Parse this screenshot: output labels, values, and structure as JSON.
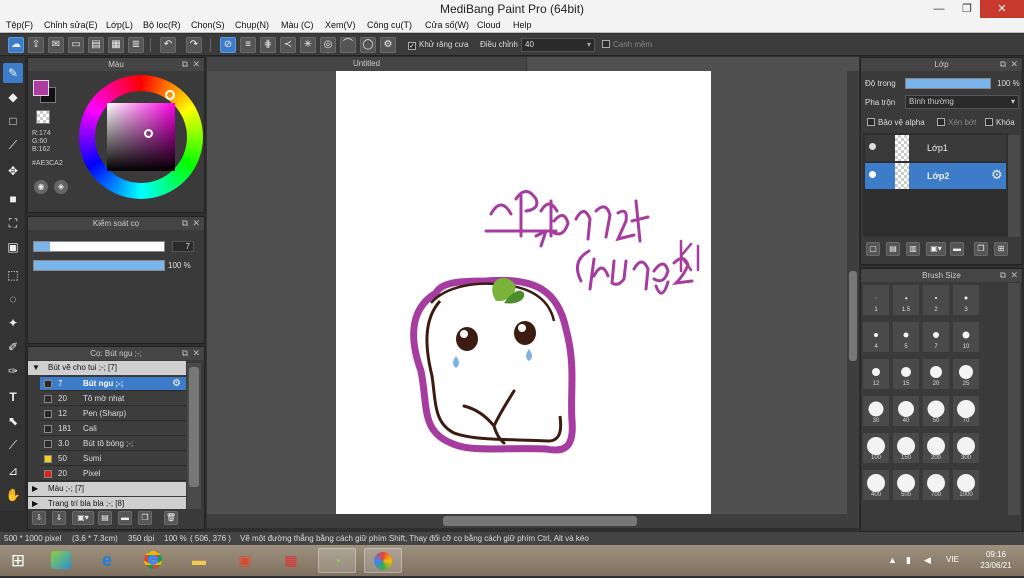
{
  "window": {
    "title": "MediBang Paint Pro (64bit)",
    "min": "—",
    "max": "❐",
    "close": "✕"
  },
  "menu": [
    "Tệp(F)",
    "Chỉnh sửa(E)",
    "Lớp(L)",
    "Bộ lọc(R)",
    "Chọn(S)",
    "Chụp(N)",
    "Màu (C)",
    "Xem(V)",
    "Công cụ(T)",
    "Cửa số(W)",
    "Cloud",
    "Help"
  ],
  "toolbar": {
    "antialias_label": "Khử răng cưa",
    "adjust_label": "Điều chỉnh",
    "adjust_value": "40",
    "edge_label": "Canh mềm"
  },
  "color_panel": {
    "title": "Màu",
    "r": "R:174",
    "g": "G:60",
    "b": "B:162",
    "hex": "#AE3CA2",
    "main_color": "#ae3ca2"
  },
  "brush_control": {
    "title": "Kiểm soát cọ",
    "size": "7",
    "opacity": "100 %"
  },
  "brush_panel": {
    "title": "Cọ: Bút ngu ;-;",
    "group1": "Bút vẽ cho tui ;-; [7]",
    "rows": [
      {
        "size": "7",
        "name": "Bút ngu ;-;",
        "color": "#2a2a2a",
        "selected": true
      },
      {
        "size": "20",
        "name": "Tô mờ nhạt",
        "color": "#2a2a2a"
      },
      {
        "size": "12",
        "name": "Pen (Sharp)",
        "color": "#2a2a2a"
      },
      {
        "size": "181",
        "name": "Cali",
        "color": "#2a2a2a"
      },
      {
        "size": "3.0",
        "name": "Bút tô bóng ;-;",
        "color": "#2a2a2a"
      },
      {
        "size": "50",
        "name": "Sumi",
        "color": "#f2d21b"
      },
      {
        "size": "20",
        "name": "Pixel",
        "color": "#e02020"
      }
    ],
    "group2": "Màu ;-; [7]",
    "group3": "Trang trí bla bla ;-; [8]"
  },
  "canvas": {
    "tab": "Untitled"
  },
  "layer_panel": {
    "title": "Lớp",
    "opacity_label": "Độ trong",
    "opacity_value": "100 %",
    "blend_label": "Pha trộn",
    "blend_value": "Bình thường",
    "protect_alpha": "Bảo vệ alpha",
    "clipping": "Xén bớt",
    "lock": "Khóa",
    "layers": [
      {
        "name": "Lớp1",
        "selected": false
      },
      {
        "name": "Lớp2",
        "selected": true
      }
    ]
  },
  "brush_size_panel": {
    "title": "Brush Size",
    "sizes": [
      "1",
      "1.5",
      "2",
      "3",
      "4",
      "5",
      "7",
      "10",
      "12",
      "15",
      "20",
      "25",
      "30",
      "40",
      "50",
      "70",
      "100",
      "150",
      "200",
      "300",
      "400",
      "500",
      "700",
      "1000"
    ]
  },
  "status": {
    "dims": "500 * 1000 pixel",
    "cm": "(3.6 * 7.3cm)",
    "dpi": "350 dpi",
    "zoom": "100 %",
    "pos": "( 506, 376 )",
    "hint": "Vẽ một đường thẳng bằng cách giữ phím Shift, Thay đổi cỡ cọ bằng cách giữ phím Ctrl, Alt và kéo"
  },
  "taskbar": {
    "lang": "VIE",
    "time": "09:16",
    "date": "23/06/21"
  }
}
